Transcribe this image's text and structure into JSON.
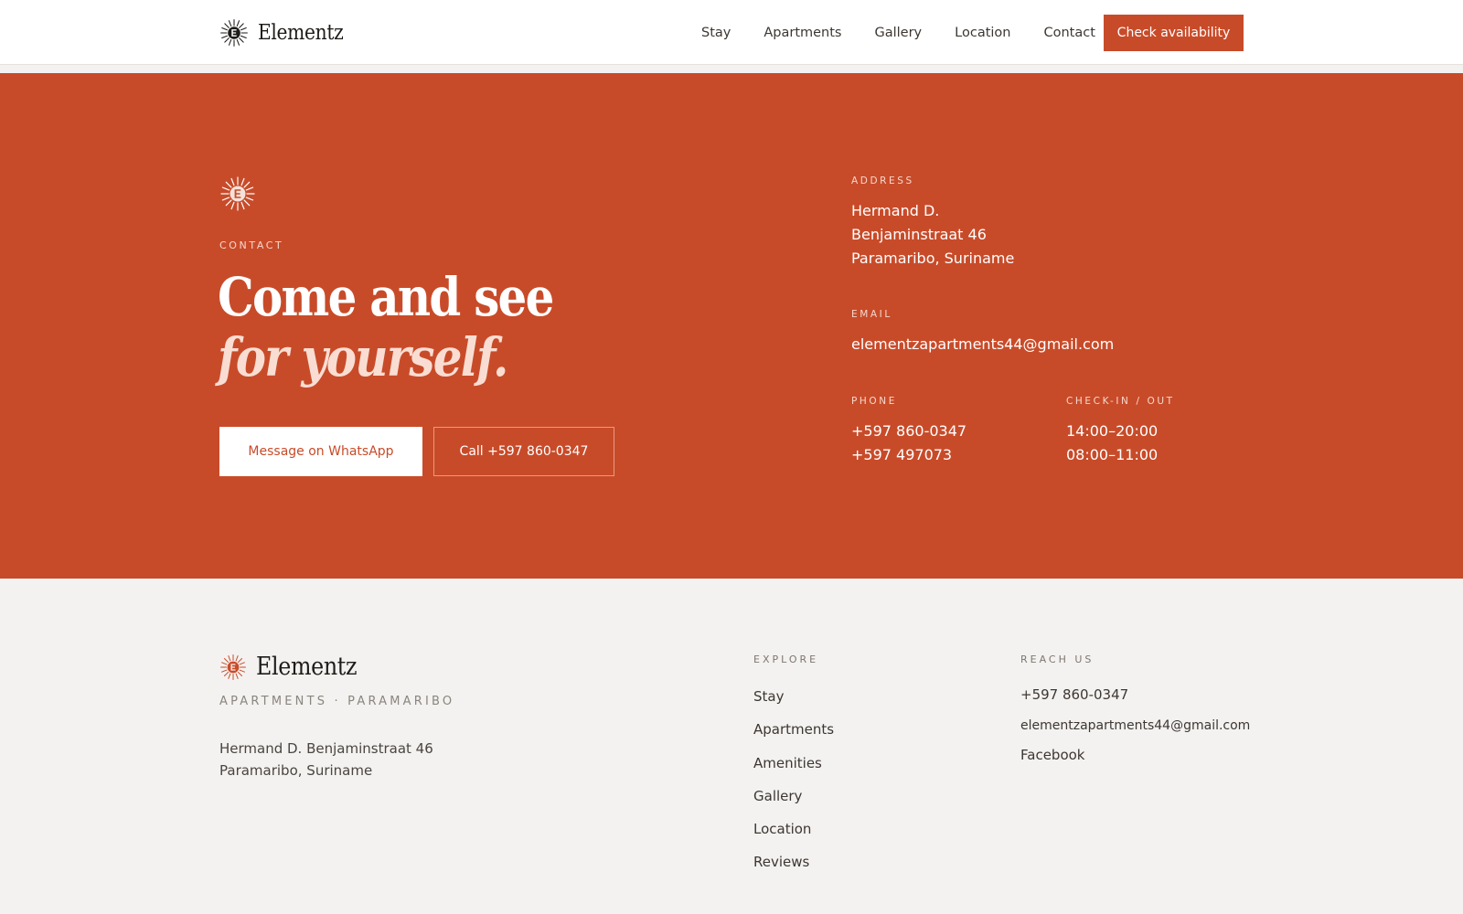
{
  "header": {
    "brand_name": "Elementz",
    "nav": [
      {
        "label": "Stay"
      },
      {
        "label": "Apartments"
      },
      {
        "label": "Gallery"
      },
      {
        "label": "Location"
      },
      {
        "label": "Contact"
      }
    ],
    "cta_label": "Check availability"
  },
  "contact": {
    "eyebrow": "CONTACT",
    "headline_line1": "Come and see",
    "headline_line2": "for yourself.",
    "whatsapp_label": "Message on WhatsApp",
    "call_label": "Call +597 860-0347",
    "address_label": "ADDRESS",
    "address_lines": [
      "Hermand D.",
      "Benjaminstraat 46",
      "Paramaribo, Suriname"
    ],
    "email_label": "EMAIL",
    "email": "elementzapartments44@gmail.com",
    "phone_label": "PHONE",
    "phones": [
      "+597 860-0347",
      "+597 497073"
    ],
    "checkin_label": "CHECK-IN / OUT",
    "checkin_times": [
      "14:00–20:00",
      "08:00–11:00"
    ]
  },
  "footer": {
    "brand_name": "Elementz",
    "subtitle": "APARTMENTS · PARAMARIBO",
    "address_lines": [
      "Hermand D. Benjaminstraat 46",
      "Paramaribo, Suriname"
    ],
    "explore_label": "EXPLORE",
    "explore_links": [
      {
        "label": "Stay"
      },
      {
        "label": "Apartments"
      },
      {
        "label": "Amenities"
      },
      {
        "label": "Gallery"
      },
      {
        "label": "Location"
      },
      {
        "label": "Reviews"
      }
    ],
    "reach_label": "REACH US",
    "reach_phone": "+597 860-0347",
    "reach_email": "elementzapartments44@gmail.com",
    "reach_social": "Facebook"
  },
  "colors": {
    "accent": "#c84b29",
    "footer_bg": "#f3f2f0",
    "header_bg": "#ffffff"
  },
  "icons": {
    "brand_logo": "sunburst-e-logo-icon"
  }
}
